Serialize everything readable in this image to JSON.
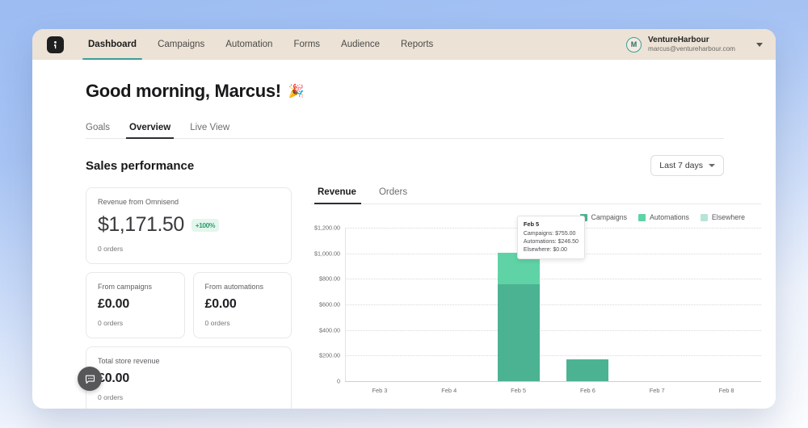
{
  "topnav": {
    "logo_icon": "brand-logo-icon",
    "items": [
      {
        "label": "Dashboard",
        "active": true
      },
      {
        "label": "Campaigns",
        "active": false
      },
      {
        "label": "Automation",
        "active": false
      },
      {
        "label": "Forms",
        "active": false
      },
      {
        "label": "Audience",
        "active": false
      },
      {
        "label": "Reports",
        "active": false
      }
    ],
    "profile": {
      "avatar_initial": "M",
      "name": "VentureHarbour",
      "email": "marcus@ventureharbour.com",
      "chevron_icon": "chevron-down-icon"
    }
  },
  "page": {
    "greeting": "Good morning, Marcus!",
    "greeting_emoji": "🎉",
    "subtabs": [
      {
        "label": "Goals",
        "active": false
      },
      {
        "label": "Overview",
        "active": true
      },
      {
        "label": "Live View",
        "active": false
      }
    ],
    "section_title": "Sales performance",
    "date_range": "Last 7 days"
  },
  "cards": {
    "primary": {
      "label": "Revenue from Omnisend",
      "value": "$1,171.50",
      "badge": "+100%",
      "sub": "0 orders"
    },
    "secondary": [
      {
        "label": "From campaigns",
        "value": "£0.00",
        "sub": "0 orders"
      },
      {
        "label": "From automations",
        "value": "£0.00",
        "sub": "0 orders"
      }
    ],
    "total": {
      "label": "Total store revenue",
      "value": "£0.00",
      "sub": "0 orders"
    }
  },
  "chart_panel": {
    "tabs": [
      {
        "label": "Revenue",
        "active": true
      },
      {
        "label": "Orders",
        "active": false
      }
    ],
    "tooltip": {
      "title": "Feb 5",
      "rows": [
        "Campaigns: $755.00",
        "Automations: $246.50",
        "Elsewhere: $0.00"
      ]
    }
  },
  "colors": {
    "campaigns": "#4cb392",
    "automations": "#5fd3a6",
    "elsewhere": "#b9e3d8",
    "accent_teal": "#3c9e96",
    "badge_green": "#2f9e70",
    "header_cream": "#ece2d6"
  },
  "chart_data": {
    "type": "bar",
    "stacked": true,
    "title": "",
    "xlabel": "",
    "ylabel": "",
    "categories": [
      "Feb 3",
      "Feb 4",
      "Feb 5",
      "Feb 6",
      "Feb 7",
      "Feb 8"
    ],
    "ytick_labels": [
      "$1,200.00",
      "$1,000.00",
      "$800.00",
      "$600.00",
      "$400.00",
      "$200.00",
      "0"
    ],
    "ytick_values": [
      1200,
      1000,
      800,
      600,
      400,
      200,
      0
    ],
    "ylim": [
      0,
      1200
    ],
    "grid": true,
    "legend_position": "top-right",
    "series": [
      {
        "name": "Campaigns",
        "color": "#4cb392",
        "values": [
          0,
          0,
          755,
          170,
          0,
          0
        ]
      },
      {
        "name": "Automations",
        "color": "#5fd3a6",
        "values": [
          0,
          0,
          246.5,
          0,
          0,
          0
        ]
      },
      {
        "name": "Elsewhere",
        "color": "#b9e3d8",
        "values": [
          0,
          0,
          0,
          0,
          0,
          0
        ]
      }
    ],
    "annotations": [
      {
        "category": "Feb 5",
        "title": "Feb 5",
        "lines": [
          "Campaigns: $755.00",
          "Automations: $246.50",
          "Elsewhere: $0.00"
        ]
      }
    ]
  },
  "chat_widget": {
    "icon": "chat-bubble-icon"
  }
}
